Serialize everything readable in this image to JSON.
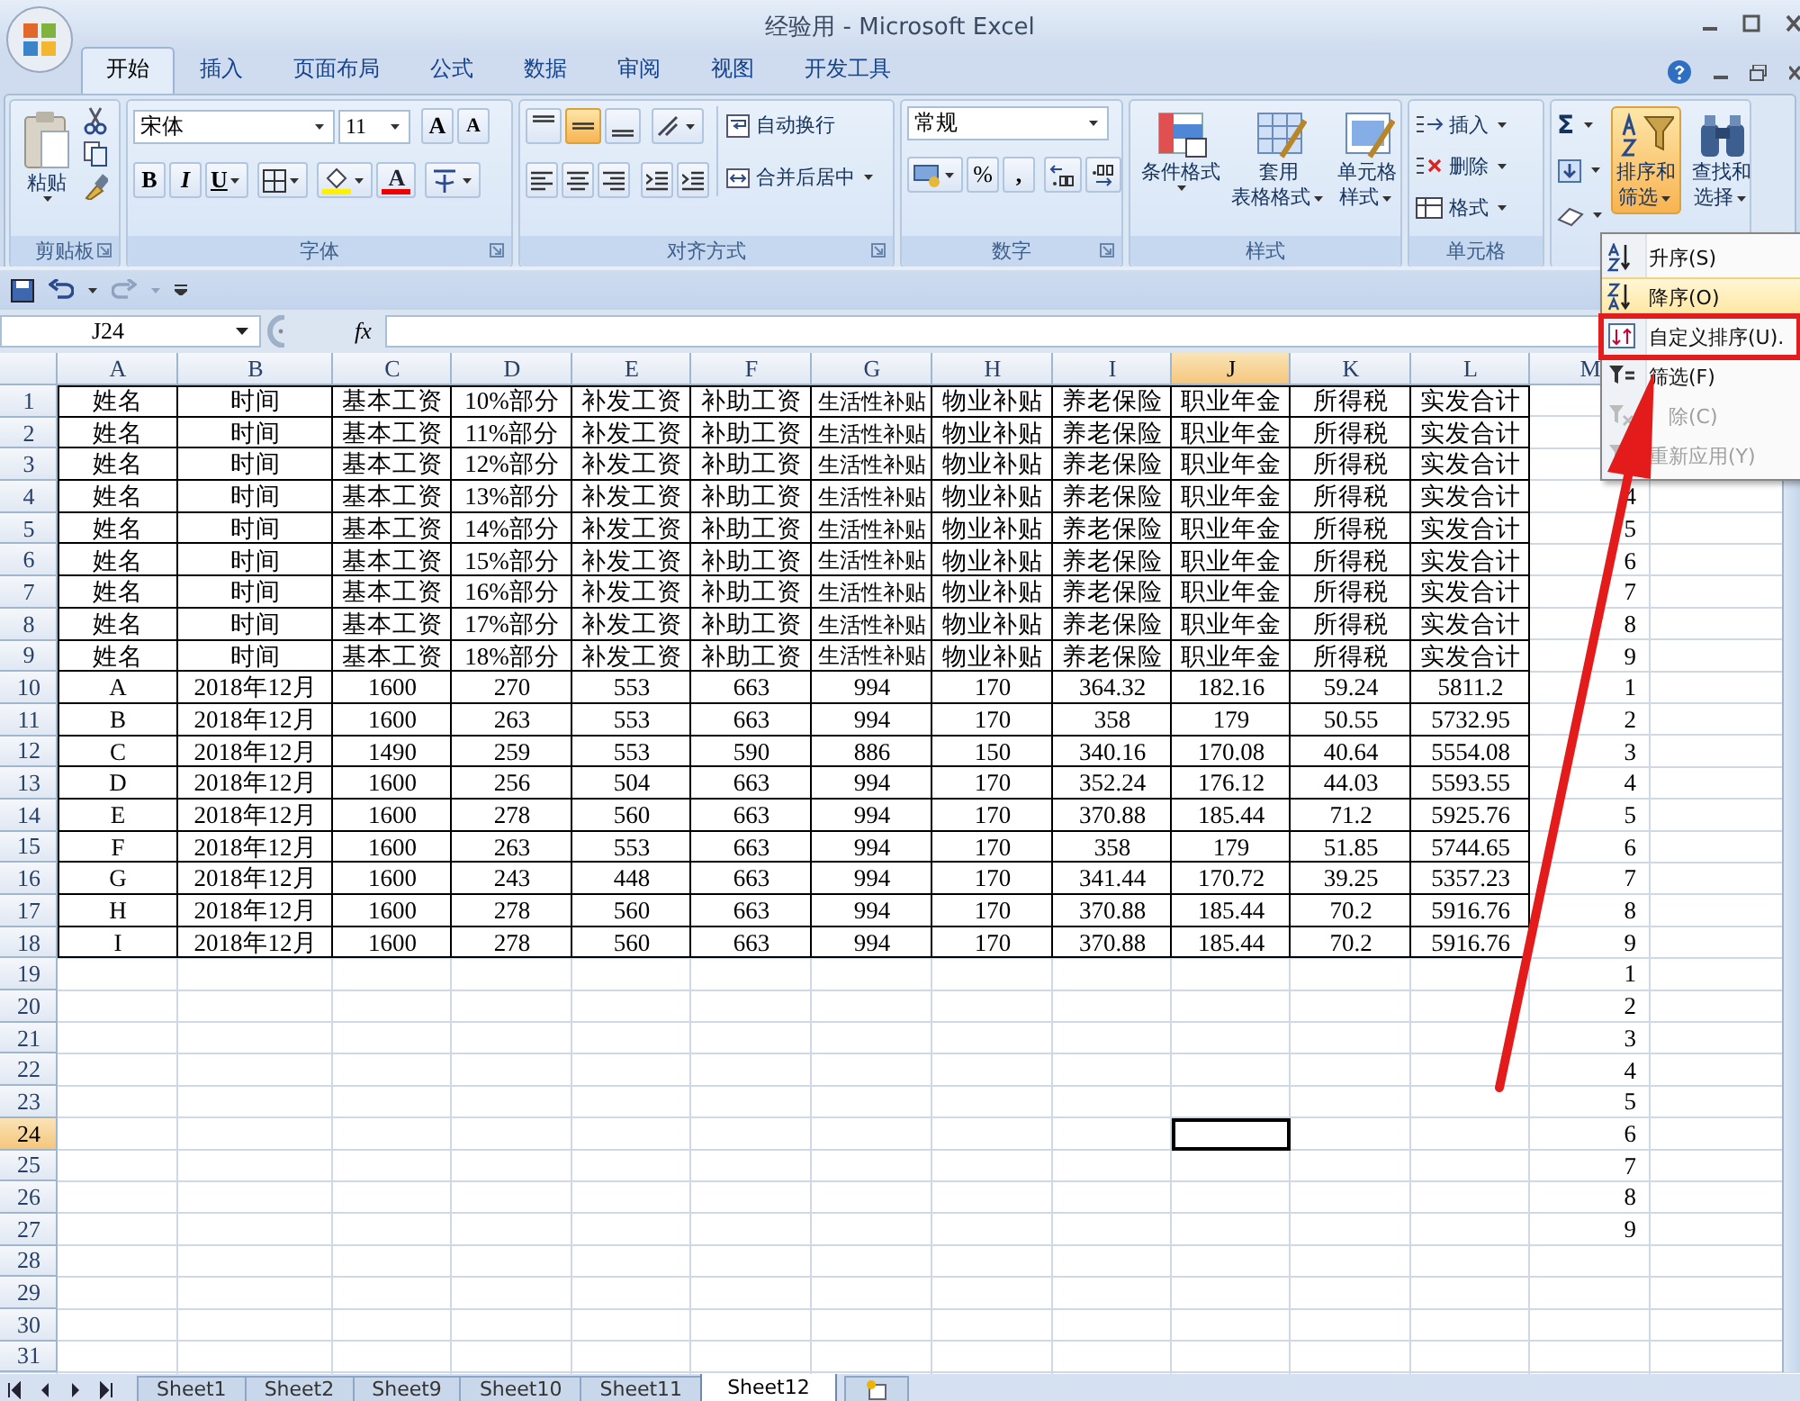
{
  "window": {
    "title": "经验用 - Microsoft Excel"
  },
  "tabs": [
    {
      "label": "开始",
      "selected": true
    },
    {
      "label": "插入",
      "selected": false
    },
    {
      "label": "页面布局",
      "selected": false
    },
    {
      "label": "公式",
      "selected": false
    },
    {
      "label": "数据",
      "selected": false
    },
    {
      "label": "审阅",
      "selected": false
    },
    {
      "label": "视图",
      "selected": false
    },
    {
      "label": "开发工具",
      "selected": false
    }
  ],
  "ribbon": [
    {
      "kind": "clipboard",
      "label": "剪贴板",
      "paste": "粘贴"
    },
    {
      "kind": "font",
      "label": "字体",
      "font_name": "宋体",
      "font_size": "11",
      "grow": "A",
      "shrink": "A",
      "bold": "B",
      "italic": "I",
      "underline": "U",
      "font_color": "A"
    },
    {
      "kind": "alignment",
      "label": "对齐方式",
      "vertical_buttons": [
        {
          "selected": false
        },
        {
          "selected": true
        },
        {
          "selected": false
        }
      ],
      "wrap": "自动换行",
      "merge": "合并后居中"
    },
    {
      "kind": "number",
      "label": "数字",
      "format": "常规",
      "percent": "%",
      "comma": ","
    },
    {
      "kind": "styles",
      "label": "样式",
      "buttons": [
        {
          "lines": [
            "条件格式"
          ]
        },
        {
          "lines": [
            "套用",
            "表格格式"
          ]
        },
        {
          "lines": [
            "单元格",
            "样式"
          ]
        }
      ]
    },
    {
      "kind": "cells",
      "label": "单元格",
      "buttons": [
        "插入",
        "删除",
        "格式"
      ]
    },
    {
      "kind": "editing",
      "sigma": "Σ",
      "buttons": [
        {
          "lines": [
            "排序和",
            "筛选"
          ],
          "pressed": true
        },
        {
          "lines": [
            "查找和",
            "选择"
          ],
          "pressed": false
        }
      ]
    }
  ],
  "formula_bar": {
    "name_box": "J24",
    "fx": "fx"
  },
  "sheet": {
    "columns": [
      {
        "label": "A",
        "selected": false
      },
      {
        "label": "B",
        "selected": false
      },
      {
        "label": "C",
        "selected": false
      },
      {
        "label": "D",
        "selected": false
      },
      {
        "label": "E",
        "selected": false
      },
      {
        "label": "F",
        "selected": false
      },
      {
        "label": "G",
        "selected": false
      },
      {
        "label": "H",
        "selected": false
      },
      {
        "label": "I",
        "selected": false
      },
      {
        "label": "J",
        "selected": true
      },
      {
        "label": "K",
        "selected": false
      },
      {
        "label": "L",
        "selected": false
      },
      {
        "label": "M",
        "selected": false
      }
    ],
    "rows": [
      {
        "header": "1",
        "selected": false,
        "cells": [
          "姓名",
          "时间",
          "基本工资",
          "10%部分",
          "补发工资",
          "补助工资",
          "生活性补贴",
          "物业补贴",
          "养老保险",
          "职业年金",
          "所得税",
          "实发合计"
        ]
      },
      {
        "header": "2",
        "selected": false,
        "cells": [
          "姓名",
          "时间",
          "基本工资",
          "11%部分",
          "补发工资",
          "补助工资",
          "生活性补贴",
          "物业补贴",
          "养老保险",
          "职业年金",
          "所得税",
          "实发合计"
        ]
      },
      {
        "header": "3",
        "selected": false,
        "cells": [
          "姓名",
          "时间",
          "基本工资",
          "12%部分",
          "补发工资",
          "补助工资",
          "生活性补贴",
          "物业补贴",
          "养老保险",
          "职业年金",
          "所得税",
          "实发合计"
        ]
      },
      {
        "header": "4",
        "selected": false,
        "cells": [
          "姓名",
          "时间",
          "基本工资",
          "13%部分",
          "补发工资",
          "补助工资",
          "生活性补贴",
          "物业补贴",
          "养老保险",
          "职业年金",
          "所得税",
          "实发合计"
        ],
        "column_m": "4"
      },
      {
        "header": "5",
        "selected": false,
        "cells": [
          "姓名",
          "时间",
          "基本工资",
          "14%部分",
          "补发工资",
          "补助工资",
          "生活性补贴",
          "物业补贴",
          "养老保险",
          "职业年金",
          "所得税",
          "实发合计"
        ],
        "column_m": "5"
      },
      {
        "header": "6",
        "selected": false,
        "cells": [
          "姓名",
          "时间",
          "基本工资",
          "15%部分",
          "补发工资",
          "补助工资",
          "生活性补贴",
          "物业补贴",
          "养老保险",
          "职业年金",
          "所得税",
          "实发合计"
        ],
        "column_m": "6"
      },
      {
        "header": "7",
        "selected": false,
        "cells": [
          "姓名",
          "时间",
          "基本工资",
          "16%部分",
          "补发工资",
          "补助工资",
          "生活性补贴",
          "物业补贴",
          "养老保险",
          "职业年金",
          "所得税",
          "实发合计"
        ],
        "column_m": "7"
      },
      {
        "header": "8",
        "selected": false,
        "cells": [
          "姓名",
          "时间",
          "基本工资",
          "17%部分",
          "补发工资",
          "补助工资",
          "生活性补贴",
          "物业补贴",
          "养老保险",
          "职业年金",
          "所得税",
          "实发合计"
        ],
        "column_m": "8"
      },
      {
        "header": "9",
        "selected": false,
        "cells": [
          "姓名",
          "时间",
          "基本工资",
          "18%部分",
          "补发工资",
          "补助工资",
          "生活性补贴",
          "物业补贴",
          "养老保险",
          "职业年金",
          "所得税",
          "实发合计"
        ],
        "column_m": "9"
      },
      {
        "header": "10",
        "selected": false,
        "cells": [
          "A",
          "2018年12月",
          "1600",
          "270",
          "553",
          "663",
          "994",
          "170",
          "364.32",
          "182.16",
          "59.24",
          "5811.2"
        ],
        "column_m": "1"
      },
      {
        "header": "11",
        "selected": false,
        "cells": [
          "B",
          "2018年12月",
          "1600",
          "263",
          "553",
          "663",
          "994",
          "170",
          "358",
          "179",
          "50.55",
          "5732.95"
        ],
        "column_m": "2"
      },
      {
        "header": "12",
        "selected": false,
        "cells": [
          "C",
          "2018年12月",
          "1490",
          "259",
          "553",
          "590",
          "886",
          "150",
          "340.16",
          "170.08",
          "40.64",
          "5554.08"
        ],
        "column_m": "3"
      },
      {
        "header": "13",
        "selected": false,
        "cells": [
          "D",
          "2018年12月",
          "1600",
          "256",
          "504",
          "663",
          "994",
          "170",
          "352.24",
          "176.12",
          "44.03",
          "5593.55"
        ],
        "column_m": "4"
      },
      {
        "header": "14",
        "selected": false,
        "cells": [
          "E",
          "2018年12月",
          "1600",
          "278",
          "560",
          "663",
          "994",
          "170",
          "370.88",
          "185.44",
          "71.2",
          "5925.76"
        ],
        "column_m": "5"
      },
      {
        "header": "15",
        "selected": false,
        "cells": [
          "F",
          "2018年12月",
          "1600",
          "263",
          "553",
          "663",
          "994",
          "170",
          "358",
          "179",
          "51.85",
          "5744.65"
        ],
        "column_m": "6"
      },
      {
        "header": "16",
        "selected": false,
        "cells": [
          "G",
          "2018年12月",
          "1600",
          "243",
          "448",
          "663",
          "994",
          "170",
          "341.44",
          "170.72",
          "39.25",
          "5357.23"
        ],
        "column_m": "7"
      },
      {
        "header": "17",
        "selected": false,
        "cells": [
          "H",
          "2018年12月",
          "1600",
          "278",
          "560",
          "663",
          "994",
          "170",
          "370.88",
          "185.44",
          "70.2",
          "5916.76"
        ],
        "column_m": "8"
      },
      {
        "header": "18",
        "selected": false,
        "cells": [
          "I",
          "2018年12月",
          "1600",
          "278",
          "560",
          "663",
          "994",
          "170",
          "370.88",
          "185.44",
          "70.2",
          "5916.76"
        ],
        "column_m": "9"
      },
      {
        "header": "19",
        "selected": false,
        "column_m": "1"
      },
      {
        "header": "20",
        "selected": false,
        "column_m": "2"
      },
      {
        "header": "21",
        "selected": false,
        "column_m": "3"
      },
      {
        "header": "22",
        "selected": false,
        "column_m": "4"
      },
      {
        "header": "23",
        "selected": false,
        "column_m": "5"
      },
      {
        "header": "24",
        "selected": true,
        "column_m": "6"
      },
      {
        "header": "25",
        "selected": false,
        "column_m": "7"
      },
      {
        "header": "26",
        "selected": false,
        "column_m": "8"
      },
      {
        "header": "27",
        "selected": false,
        "column_m": "9"
      },
      {
        "header": "28",
        "selected": false
      },
      {
        "header": "29",
        "selected": false
      },
      {
        "header": "30",
        "selected": false
      },
      {
        "header": "31",
        "selected": false
      }
    ]
  },
  "sheet_tabs": [
    {
      "label": "Sheet1",
      "selected": false
    },
    {
      "label": "Sheet2",
      "selected": false
    },
    {
      "label": "Sheet9",
      "selected": false
    },
    {
      "label": "Sheet10",
      "selected": false
    },
    {
      "label": "Sheet11",
      "selected": false
    },
    {
      "label": "Sheet12",
      "selected": true
    }
  ],
  "sort_menu": [
    {
      "label": "升序(S)",
      "hovered": false,
      "disabled": false,
      "annotated": false
    },
    {
      "label": "降序(O)",
      "hovered": true,
      "disabled": false,
      "annotated": false
    },
    {
      "label": "自定义排序(U).",
      "hovered": false,
      "disabled": false,
      "annotated": true
    },
    {
      "label": "筛选(F)",
      "hovered": false,
      "disabled": false,
      "annotated": false
    },
    {
      "label": "除(C)",
      "hovered": false,
      "disabled": true,
      "annotated": false
    },
    {
      "label": "重新应用(Y)",
      "hovered": false,
      "disabled": true,
      "annotated": false
    }
  ]
}
